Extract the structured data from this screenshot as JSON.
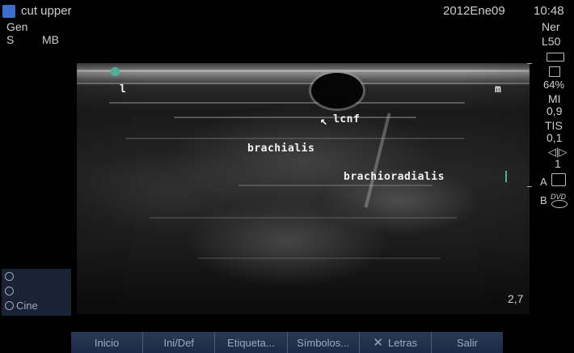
{
  "header": {
    "preset_name": "cut upper",
    "date": "2012Ene09",
    "time": "10:48"
  },
  "left_info": {
    "mode": "Gen",
    "s_label": "S",
    "mb_label": "MB"
  },
  "right_info": {
    "ner": "Ner",
    "probe": "L50",
    "battery_pct": "64%",
    "mi_label": "MI",
    "mi_value": "0,9",
    "tis_label": "TIS",
    "tis_value": "0,1",
    "gain_value": "1",
    "a_label": "A",
    "b_label": "B",
    "dvd_label": "DVD"
  },
  "image_labels": {
    "lateral": "l",
    "medial": "m",
    "lcnf": "lcnf",
    "brachialis": "brachialis",
    "brachioradialis": "brachioradialis"
  },
  "depth_value": "2,7",
  "cine_panel": {
    "cine_label": "Cine"
  },
  "buttons": [
    {
      "label": "Inicio"
    },
    {
      "label": "Ini/Def"
    },
    {
      "label": "Etiqueta..."
    },
    {
      "label": "Símbolos..."
    },
    {
      "label": "Letras"
    },
    {
      "label": "Salir"
    }
  ],
  "colors": {
    "marker_dot": "#4fb09a",
    "button_bg": "#1f2e49",
    "button_text": "#9aa8c0"
  }
}
